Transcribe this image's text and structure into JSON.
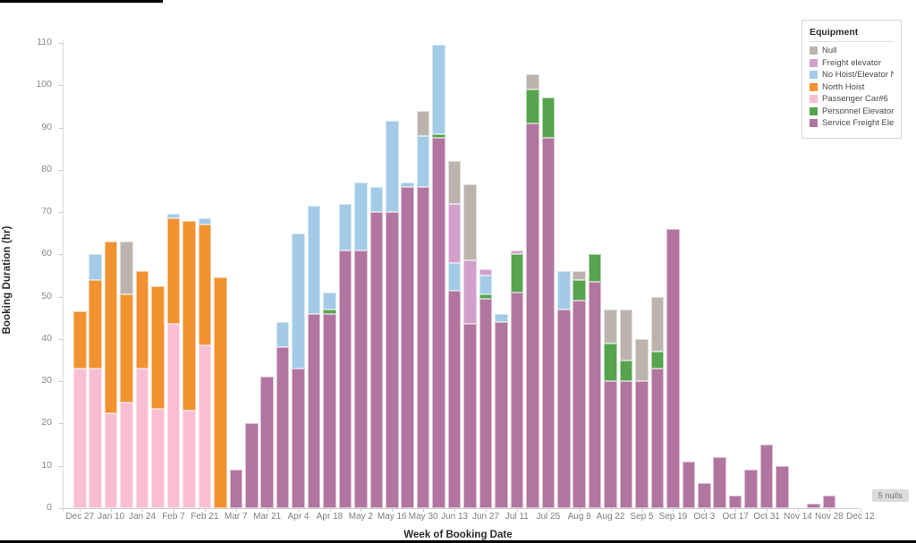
{
  "chart_data": {
    "type": "bar",
    "stacked": true,
    "title": "",
    "xlabel": "Week of Booking Date",
    "ylabel": "Booking Duration (hr)",
    "ylim": [
      0,
      110
    ],
    "ytick_values": [
      0,
      10,
      20,
      30,
      40,
      50,
      60,
      70,
      80,
      90,
      100,
      110
    ],
    "grid": false,
    "legend": {
      "title": "Equipment",
      "position": "top-right",
      "entries": [
        {
          "label": "Null",
          "color": "#bdb3ae"
        },
        {
          "label": "Freight elevator",
          "color": "#d2a0cb"
        },
        {
          "label": "No Hoist/Elevator N..",
          "color": "#a3cbe8"
        },
        {
          "label": "North Hoist",
          "color": "#f2912f"
        },
        {
          "label": "Passenger Car#6",
          "color": "#f9bed3"
        },
        {
          "label": "Personnel Elevator",
          "color": "#56a44d"
        },
        {
          "label": "Service Freight Eleva..",
          "color": "#b2759f"
        }
      ]
    },
    "annotations": [
      {
        "text": "5 nulls",
        "position": "bottom-right"
      }
    ],
    "series_order": [
      "Service Freight Eleva..",
      "Personnel Elevator",
      "Passenger Car#6",
      "North Hoist",
      "No Hoist/Elevator N..",
      "Freight elevator",
      "Null"
    ],
    "x_tick_labels": [
      "Dec 27",
      "Jan 10",
      "Jan 24",
      "Feb 7",
      "Feb 21",
      "Mar 7",
      "Mar 21",
      "Apr 4",
      "Apr 18",
      "May 2",
      "May 16",
      "May 30",
      "Jun 13",
      "Jun 27",
      "Jul 11",
      "Jul 25",
      "Aug 8",
      "Aug 22",
      "Sep 5",
      "Sep 19",
      "Oct 3",
      "Oct 17",
      "Oct 31",
      "Nov 14",
      "Nov 28",
      "Dec 12"
    ],
    "categories": [
      "Dec 27",
      "Jan 3",
      "Jan 10",
      "Jan 17",
      "Jan 24",
      "Jan 31",
      "Feb 7",
      "Feb 14",
      "Feb 21",
      "Feb 28",
      "Mar 7",
      "Mar 14",
      "Mar 21",
      "Mar 28",
      "Apr 4",
      "Apr 11",
      "Apr 18",
      "Apr 25",
      "May 2",
      "May 9",
      "May 16",
      "May 23",
      "May 30",
      "Jun 6",
      "Jun 13",
      "Jun 20",
      "Jun 27",
      "Jul 4",
      "Jul 11",
      "Jul 18",
      "Jul 25",
      "Aug 1",
      "Aug 8",
      "Aug 15",
      "Aug 22",
      "Aug 29",
      "Sep 5",
      "Sep 12",
      "Sep 19",
      "Sep 26",
      "Oct 3",
      "Oct 10",
      "Oct 17",
      "Oct 24",
      "Oct 31",
      "Nov 7",
      "Nov 14",
      "Nov 21",
      "Nov 28",
      "Dec 5",
      "Dec 12"
    ],
    "series": [
      {
        "name": "Service Freight Eleva..",
        "color": "#b2759f",
        "values": [
          0,
          0,
          0,
          0,
          0,
          0,
          0,
          0,
          0,
          0,
          9,
          20,
          31,
          38,
          33,
          46,
          46,
          61,
          61,
          70,
          70,
          76,
          76,
          87.5,
          51.5,
          43.5,
          49.5,
          44,
          51,
          91,
          87.5,
          47,
          49,
          53.5,
          30,
          30,
          30,
          33,
          66,
          11,
          6,
          12,
          3,
          9,
          15,
          10,
          0,
          1,
          3,
          0,
          0
        ]
      },
      {
        "name": "Personnel Elevator",
        "color": "#56a44d",
        "values": [
          0,
          0,
          0,
          0,
          0,
          0,
          0,
          0,
          0,
          0,
          0,
          0,
          0,
          0,
          0,
          0,
          1,
          0,
          0,
          0,
          0,
          0,
          0,
          1,
          0,
          0,
          1,
          0,
          9,
          8,
          9.5,
          0,
          5,
          6.5,
          9,
          5,
          0,
          4,
          0,
          0,
          0,
          0,
          0,
          0,
          0,
          0,
          0,
          0,
          0,
          0,
          0
        ]
      },
      {
        "name": "Passenger Car#6",
        "color": "#f9bed3",
        "values": [
          33,
          33,
          22.5,
          25,
          33,
          23.5,
          43.5,
          23,
          38.5,
          0,
          0,
          0,
          0,
          0,
          0,
          0,
          0,
          0,
          0,
          0,
          0,
          0,
          0,
          0,
          0,
          0,
          0,
          0,
          0,
          0,
          0,
          0,
          0,
          0,
          0,
          0,
          0,
          0,
          0,
          0,
          0,
          0,
          0,
          0,
          0,
          0,
          0,
          0,
          0,
          0,
          0
        ]
      },
      {
        "name": "North Hoist",
        "color": "#f2912f",
        "values": [
          13.5,
          21,
          40.5,
          25.5,
          23,
          29,
          25,
          45,
          28.5,
          54.5,
          0,
          0,
          0,
          0,
          0,
          0,
          0,
          0,
          0,
          0,
          0,
          0,
          0,
          0,
          0,
          0,
          0,
          0,
          0,
          0,
          0,
          0,
          0,
          0,
          0,
          0,
          0,
          0,
          0,
          0,
          0,
          0,
          0,
          0,
          0,
          0,
          0,
          0,
          0,
          0,
          0
        ]
      },
      {
        "name": "No Hoist/Elevator N..",
        "color": "#a3cbe8",
        "values": [
          0,
          6,
          0,
          0,
          0,
          0,
          1,
          0,
          1.5,
          0,
          0,
          0,
          0,
          6,
          32,
          25.5,
          4,
          11,
          16,
          6,
          21.5,
          1,
          12,
          21,
          6.5,
          0,
          4.5,
          2,
          0,
          0,
          0,
          9,
          0,
          0,
          0,
          0,
          0,
          0,
          0,
          0,
          0,
          0,
          0,
          0,
          0,
          0,
          0,
          0,
          0,
          0,
          0
        ]
      },
      {
        "name": "Freight elevator",
        "color": "#d2a0cb",
        "values": [
          0,
          0,
          0,
          0,
          0,
          0,
          0,
          0,
          0,
          0,
          0,
          0,
          0,
          0,
          0,
          0,
          0,
          0,
          0,
          0,
          0,
          0,
          0,
          0,
          14,
          15,
          1.5,
          0,
          1,
          0,
          0,
          0,
          0,
          0,
          0,
          0,
          0,
          0,
          0,
          0,
          0,
          0,
          0,
          0,
          0,
          0,
          0,
          0,
          0,
          0,
          0
        ]
      },
      {
        "name": "Null",
        "color": "#bdb3ae",
        "values": [
          0,
          0,
          0,
          12.5,
          0,
          0,
          0,
          0,
          0,
          0,
          0,
          0,
          0,
          0,
          0,
          0,
          0,
          0,
          0,
          0,
          0,
          0,
          6,
          0,
          10,
          18,
          0,
          0,
          0,
          3.5,
          0,
          0,
          2,
          0,
          8,
          12,
          10,
          13,
          0,
          0,
          0,
          0,
          0,
          0,
          0,
          0,
          0,
          0,
          0,
          0,
          0
        ]
      }
    ]
  }
}
